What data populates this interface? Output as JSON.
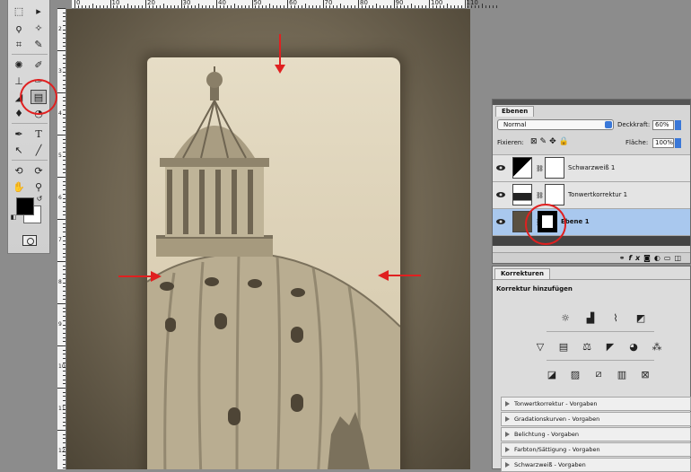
{
  "colors": {
    "annotation_red": "#e02020",
    "selection_blue": "#a9c8ee",
    "panel_gray": "#d6d6d6",
    "sepia_light": "#e6ddc6",
    "sepia_dark": "#4d4536"
  },
  "toolbox": {
    "tools": [
      {
        "icon": "marquee-icon"
      },
      {
        "icon": "move-icon"
      },
      {
        "icon": "lasso-icon"
      },
      {
        "icon": "magic-wand-icon"
      },
      {
        "icon": "crop-icon"
      },
      {
        "icon": "eyedropper-icon"
      },
      {
        "icon": "spot-healing-icon"
      },
      {
        "icon": "brush-icon"
      },
      {
        "icon": "clone-stamp-icon"
      },
      {
        "icon": "history-brush-icon"
      },
      {
        "icon": "eraser-icon"
      },
      {
        "icon": "gradient-icon"
      },
      {
        "icon": "blur-icon"
      },
      {
        "icon": "dodge-icon"
      },
      {
        "icon": "pen-icon"
      },
      {
        "icon": "type-icon"
      },
      {
        "icon": "path-select-icon"
      },
      {
        "icon": "line-icon"
      },
      {
        "icon": "3d-rotate-icon"
      },
      {
        "icon": "3d-orbit-icon"
      },
      {
        "icon": "hand-icon"
      },
      {
        "icon": "zoom-icon"
      }
    ]
  },
  "ruler": {
    "top_labels": [
      "0",
      "10",
      "20",
      "30",
      "40",
      "50",
      "60",
      "70",
      "80",
      "90",
      "100",
      "110"
    ],
    "left_labels": [
      "2",
      "3",
      "4",
      "5",
      "6",
      "7",
      "8",
      "9",
      "10",
      "11",
      "12"
    ]
  },
  "layers_panel": {
    "tab": "Ebenen",
    "blend_mode": "Normal",
    "opacity_label": "Deckkraft:",
    "opacity_value": "60%",
    "lock_label": "Fixieren:",
    "fill_label": "Fläche:",
    "fill_value": "100%",
    "layers": [
      {
        "name": "Schwarzweiß 1",
        "selected": false
      },
      {
        "name": "Tonwertkorrektur 1",
        "selected": false
      },
      {
        "name": "Ebene 1",
        "selected": true
      }
    ],
    "footer_icons": [
      "link-icon",
      "fx-icon",
      "mask-icon",
      "adjustment-icon",
      "group-icon",
      "new-layer-icon"
    ]
  },
  "adjustments_panel": {
    "tab": "Korrekturen",
    "heading": "Korrektur hinzufügen",
    "row1_icons": [
      "brightness-icon",
      "levels-icon",
      "curves-icon",
      "exposure-icon"
    ],
    "row2_icons": [
      "vibrance-icon",
      "hue-saturation-icon",
      "color-balance-icon",
      "black-white-icon",
      "photo-filter-icon",
      "channel-mixer-icon"
    ],
    "row3_icons": [
      "invert-icon",
      "posterize-icon",
      "threshold-icon",
      "gradient-map-icon",
      "selective-color-icon"
    ],
    "presets": [
      "Tonwertkorrektur - Vorgaben",
      "Gradationskurven - Vorgaben",
      "Belichtung - Vorgaben",
      "Farbton/Sättigung - Vorgaben",
      "Schwarzweiß - Vorgaben"
    ]
  }
}
